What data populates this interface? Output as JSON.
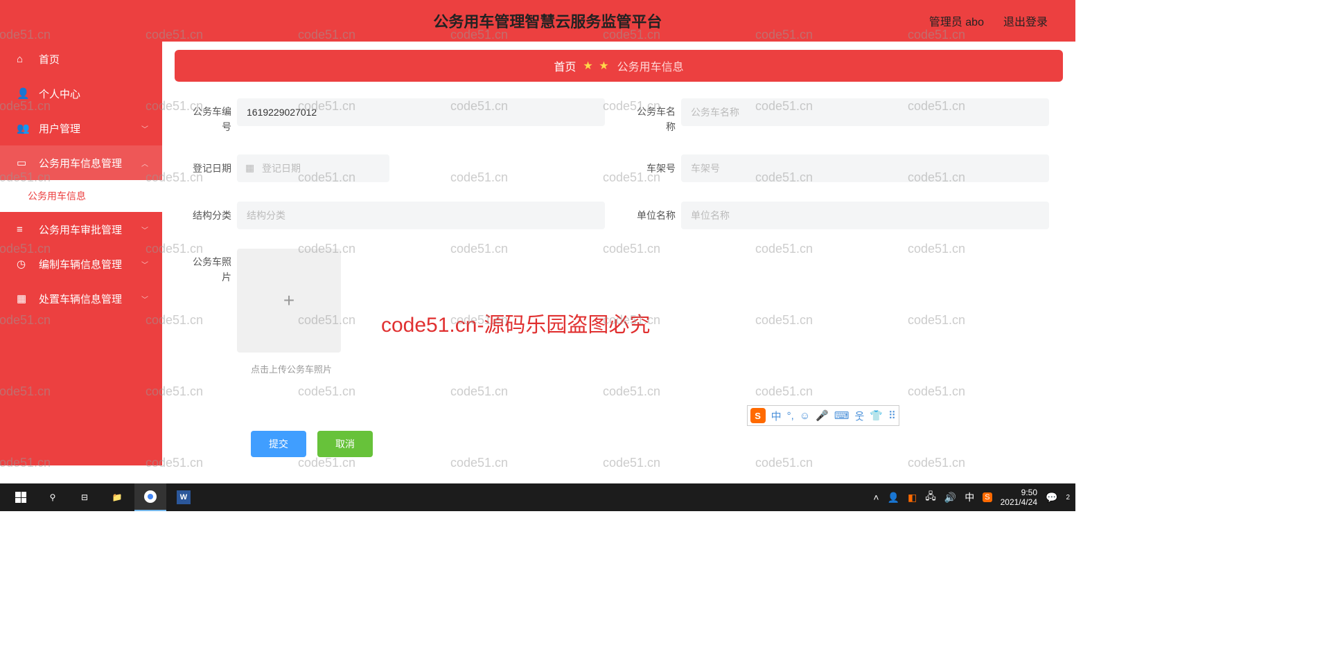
{
  "header": {
    "title": "公务用车管理智慧云服务监管平台",
    "user_prefix": "管理员",
    "user_name": "abo",
    "logout": "退出登录"
  },
  "sidebar": {
    "items": [
      {
        "label": "首页",
        "icon": "home"
      },
      {
        "label": "个人中心",
        "icon": "user"
      },
      {
        "label": "用户管理",
        "icon": "users",
        "expandable": true
      },
      {
        "label": "公务用车信息管理",
        "icon": "car",
        "expandable": true,
        "expanded": true
      },
      {
        "label": "公务用车审批管理",
        "icon": "list",
        "expandable": true
      },
      {
        "label": "编制车辆信息管理",
        "icon": "clock",
        "expandable": true
      },
      {
        "label": "处置车辆信息管理",
        "icon": "grid",
        "expandable": true
      }
    ],
    "sub_item": "公务用车信息"
  },
  "breadcrumb": {
    "home": "首页",
    "current": "公务用车信息"
  },
  "form": {
    "car_id": {
      "label": "公务车编号",
      "value": "1619229027012"
    },
    "car_name": {
      "label": "公务车名称",
      "placeholder": "公务车名称"
    },
    "reg_date": {
      "label": "登记日期",
      "placeholder": "登记日期"
    },
    "vin": {
      "label": "车架号",
      "placeholder": "车架号"
    },
    "structure": {
      "label": "结构分类",
      "placeholder": "结构分类"
    },
    "unit": {
      "label": "单位名称",
      "placeholder": "单位名称"
    },
    "photo": {
      "label": "公务车照片",
      "hint": "点击上传公务车照片"
    },
    "submit": "提交",
    "cancel": "取消"
  },
  "ime": {
    "lang": "中"
  },
  "watermark": {
    "text": "code51.cn",
    "big": "code51.cn-源码乐园盗图必究"
  },
  "taskbar": {
    "time": "9:50",
    "date": "2021/4/24",
    "ime": "中",
    "notif": "2"
  }
}
